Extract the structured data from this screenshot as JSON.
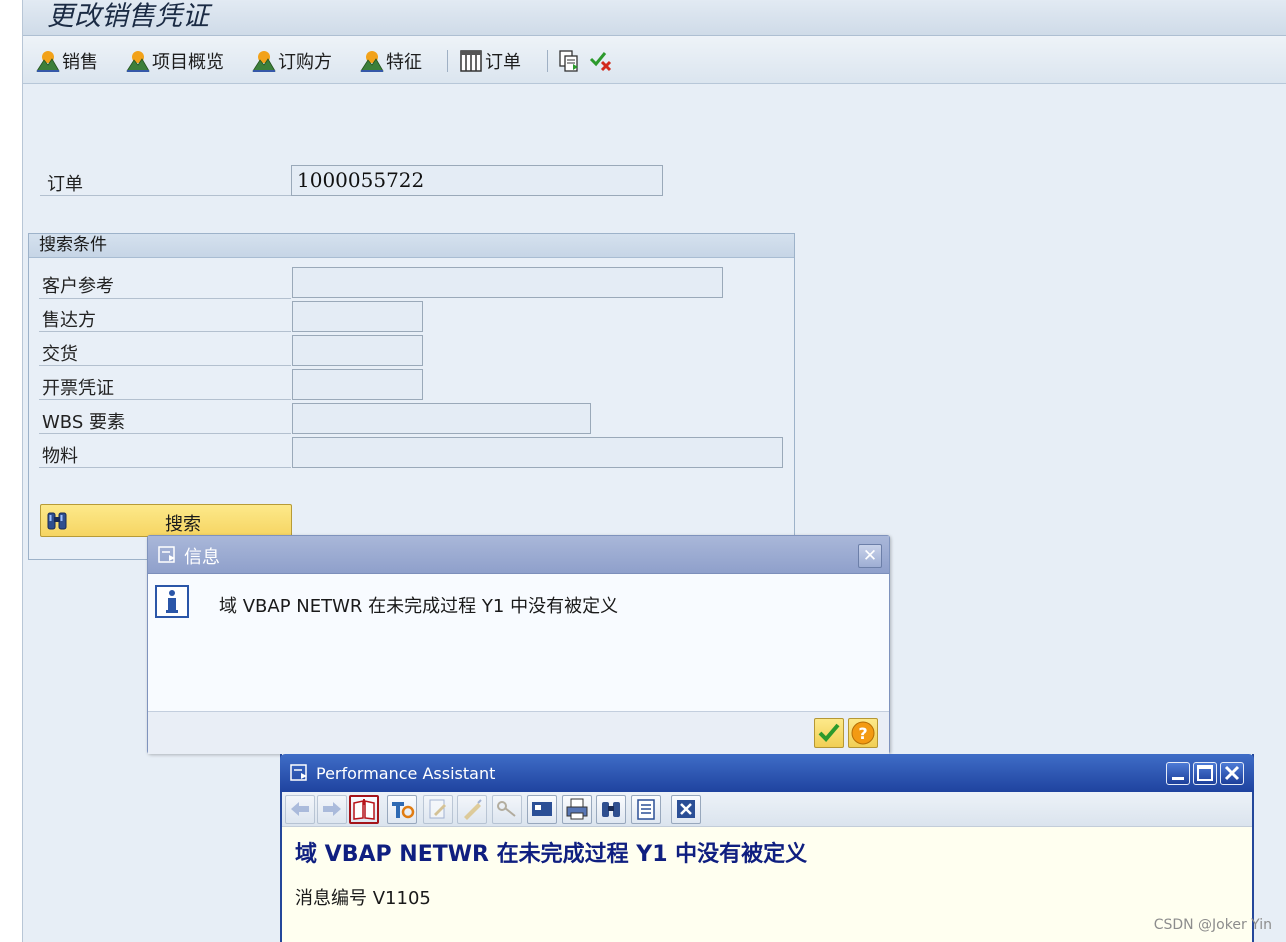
{
  "window": {
    "title": "更改销售凭证"
  },
  "toolbar": {
    "sales": "销售",
    "item_overview": "项目概览",
    "ordering_party": "订购方",
    "characteristics": "特征",
    "order": "订单"
  },
  "order_field": {
    "label": "订单",
    "value": "1000055722"
  },
  "search_criteria": {
    "title": "搜索条件",
    "fields": [
      {
        "label": "客户参考",
        "value": ""
      },
      {
        "label": "售达方",
        "value": ""
      },
      {
        "label": "交货",
        "value": ""
      },
      {
        "label": "开票凭证",
        "value": ""
      },
      {
        "label_prefix": "WBS",
        "label_suffix": " 要素",
        "value": ""
      },
      {
        "label": "物料",
        "value": ""
      }
    ],
    "search_button": "搜索"
  },
  "info_dialog": {
    "title": "信息",
    "message": {
      "p1": "域 ",
      "b1": "VBAP NETWR",
      "p2": " 在未完成过程 ",
      "b2": "Y1",
      "p3": " 中没有被定义"
    }
  },
  "performance_assistant": {
    "title": "Performance Assistant",
    "heading": {
      "p1": "域 ",
      "b1": "VBAP NETWR",
      "p2": " 在未完成过程 ",
      "b2": "Y1",
      "p3": " 中没有被定义"
    },
    "message_number": {
      "label": "消息编号 ",
      "value": "V1105"
    }
  },
  "watermark": "CSDN @Joker Yin",
  "colors": {
    "dialog_title": "#8fa0cb",
    "pa_title": "#1f439f",
    "button_yellow": "#f6d563",
    "heading_blue": "#0f1f80"
  }
}
